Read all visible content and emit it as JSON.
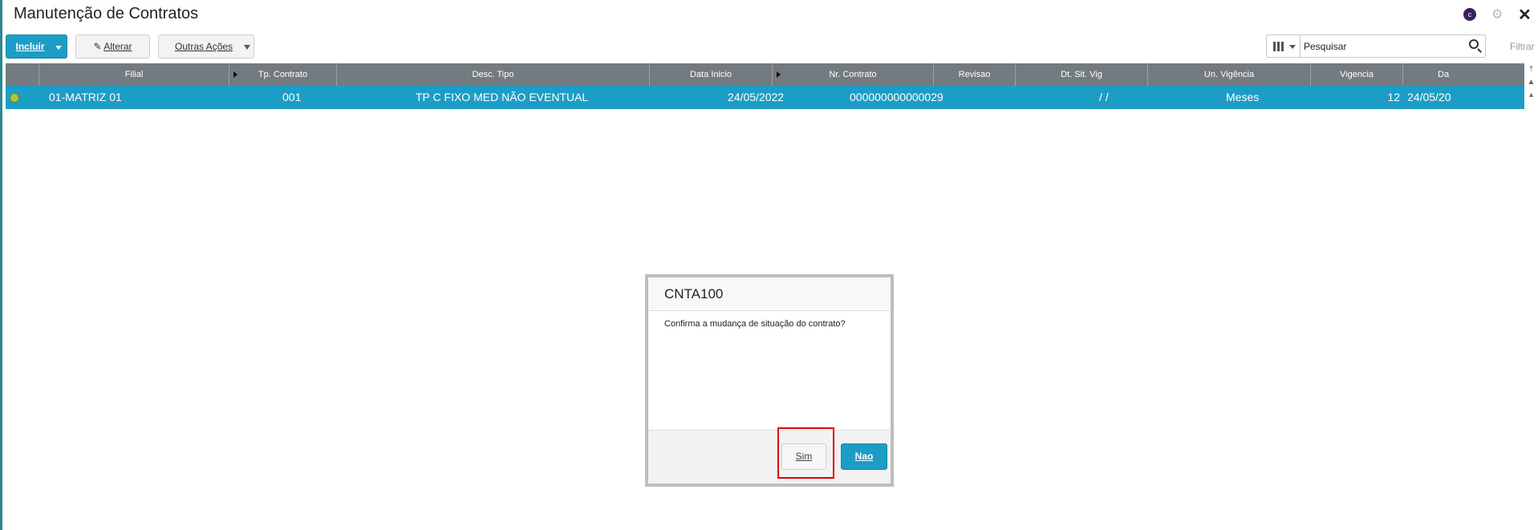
{
  "window": {
    "title": "Manutenção de Contratos",
    "close_glyph": "✕",
    "gear_glyph": "⚙",
    "app_badge": "c"
  },
  "toolbar": {
    "incluir_label": "Incluir",
    "alterar_label": "Alterar",
    "outras_label": "Outras Ações"
  },
  "search": {
    "placeholder": "Pesquisar",
    "value": "",
    "filter_label": "Filtrar"
  },
  "grid": {
    "columns": [
      "Filial",
      "Tp. Contrato",
      "Desc. Tipo",
      "Data Inicio",
      "Nr. Contrato",
      "Revisao",
      "Dt. Sit. Vig",
      "Un. Vigência",
      "Vigencia",
      "Da"
    ],
    "rows": [
      {
        "status": "green",
        "filial": "01-MATRIZ 01",
        "tp_contrato": "001",
        "desc_tipo": "TP C FIXO MED NÃO EVENTUAL",
        "data_inicio": "24/05/2022",
        "nr_contrato": "000000000000029",
        "revisao": "",
        "dt_sit_vig": "/ /",
        "un_vigencia": "Meses",
        "vigencia": "12",
        "data_extra": "24/05/20"
      }
    ]
  },
  "dialog": {
    "title": "CNTA100",
    "message": "Confirma a mudança de situação do contrato?",
    "yes_label": "Sim",
    "no_label": "Nao"
  },
  "colors": {
    "accent": "#1c9dc6",
    "header": "#737b80",
    "highlight": "#e00000"
  }
}
